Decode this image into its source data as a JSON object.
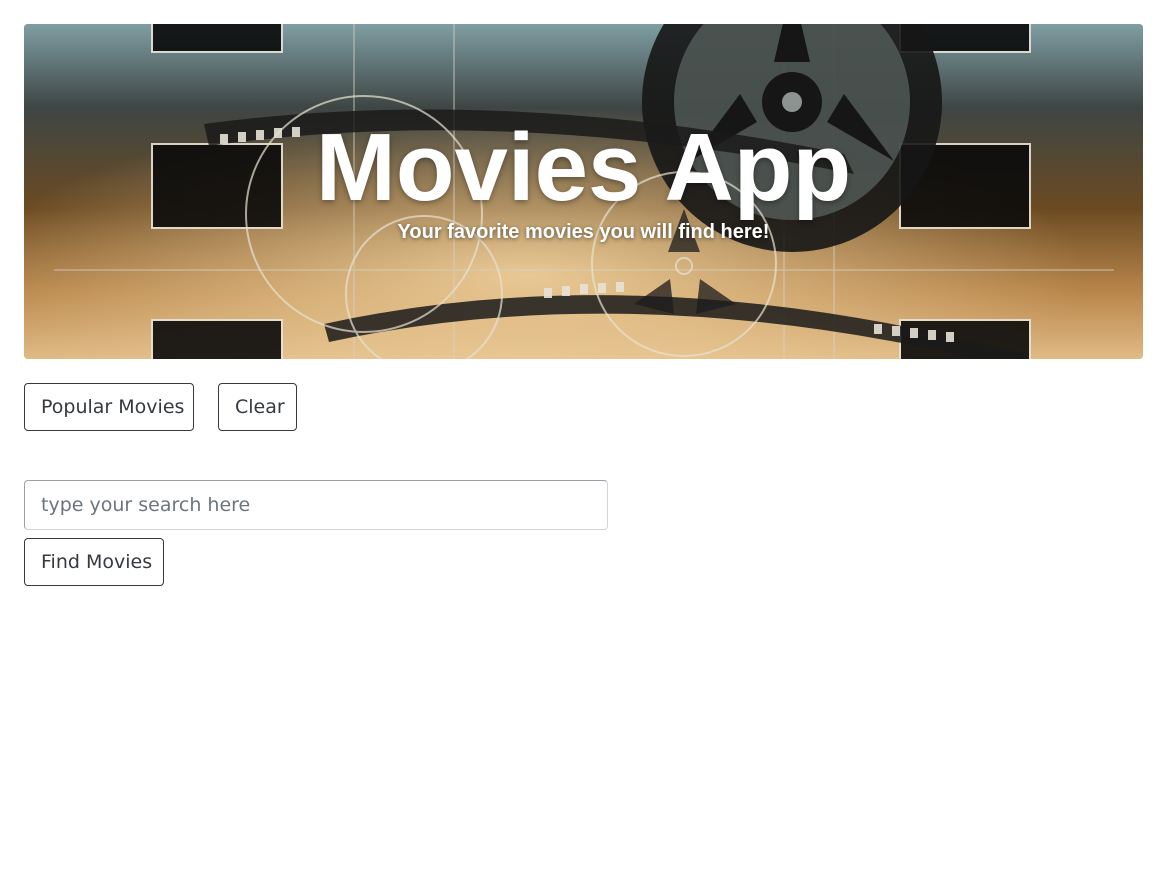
{
  "hero": {
    "title": "Movies App",
    "subtitle": "Your favorite movies you will find here!",
    "image_icon": "film-reel-background"
  },
  "actions": {
    "popular_label": "Popular Movies",
    "clear_label": "Clear"
  },
  "search": {
    "value": "",
    "placeholder": "type your search here",
    "submit_label": "Find Movies"
  },
  "colors": {
    "button_border": "#343a40",
    "hero_text": "#ffffff"
  }
}
